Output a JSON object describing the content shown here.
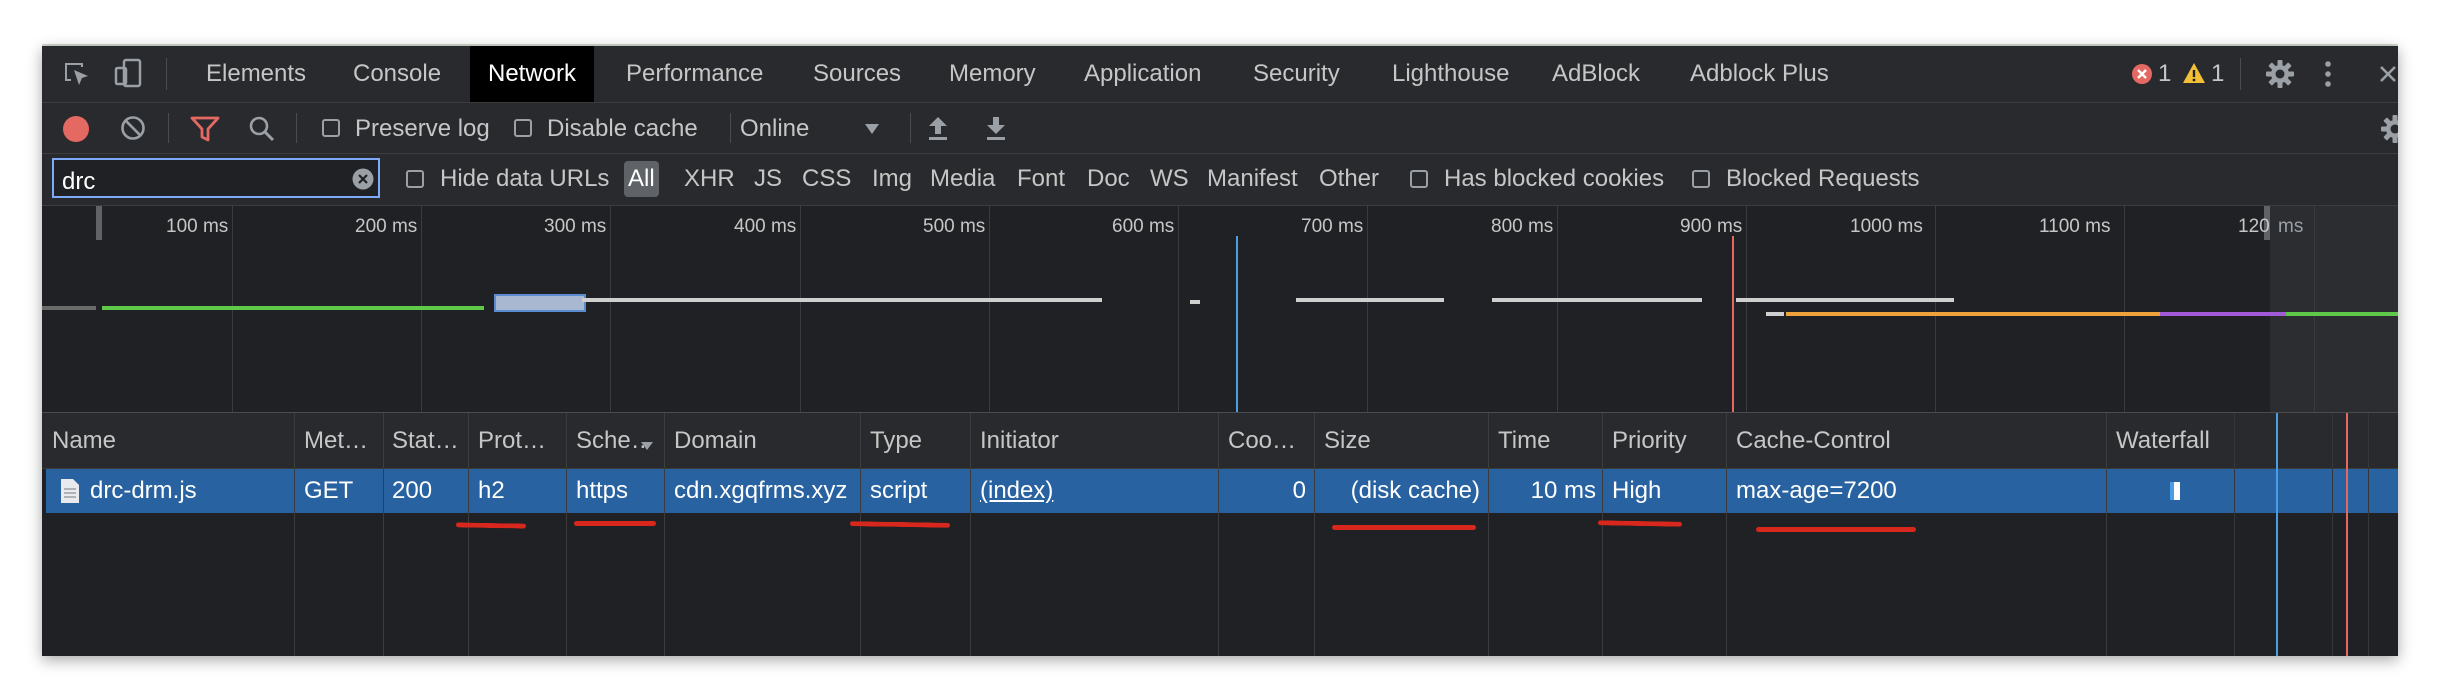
{
  "tabs": {
    "items": [
      "Elements",
      "Console",
      "Network",
      "Performance",
      "Sources",
      "Memory",
      "Application",
      "Security",
      "Lighthouse",
      "AdBlock",
      "Adblock Plus"
    ],
    "active": "Network",
    "errors": "1",
    "warnings": "1"
  },
  "toolbar": {
    "preserve_log": "Preserve log",
    "disable_cache": "Disable cache",
    "throttling": "Online"
  },
  "filter": {
    "search_value": "drc",
    "hide_data_urls": "Hide data URLs",
    "types": [
      "All",
      "XHR",
      "JS",
      "CSS",
      "Img",
      "Media",
      "Font",
      "Doc",
      "WS",
      "Manifest",
      "Other"
    ],
    "active_type": "All",
    "has_blocked_cookies": "Has blocked cookies",
    "blocked_requests": "Blocked Requests"
  },
  "overview": {
    "ticks": [
      "100 ms",
      "200 ms",
      "300 ms",
      "400 ms",
      "500 ms",
      "600 ms",
      "700 ms",
      "800 ms",
      "900 ms",
      "1000 ms",
      "1100 ms",
      "120",
      "ms"
    ]
  },
  "table": {
    "columns": [
      "Name",
      "Met…",
      "Stat…",
      "Prot…",
      "Sche…",
      "Domain",
      "Type",
      "Initiator",
      "Coo…",
      "Size",
      "Time",
      "Priority",
      "Cache-Control",
      "Waterfall"
    ],
    "rows": [
      {
        "name": "drc-drm.js",
        "method": "GET",
        "status": "200",
        "protocol": "h2",
        "scheme": "https",
        "domain": "cdn.xgqfrms.xyz",
        "type": "script",
        "initiator": "(index)",
        "cookies": "0",
        "size": "(disk cache)",
        "time": "10 ms",
        "priority": "High",
        "cache_control": "max-age=7200"
      }
    ]
  },
  "colors": {
    "panel_bg": "#202124",
    "toolbar_bg": "#292a2d",
    "selected_row": "#2862a0",
    "record_red": "#e46962",
    "annotation_red": "#d8271c"
  }
}
